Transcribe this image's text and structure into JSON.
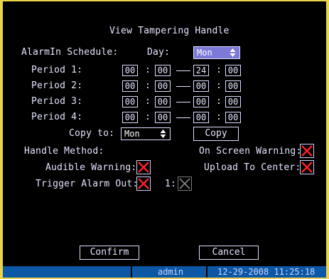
{
  "title": "View Tampering Handle",
  "schedule": {
    "label": "AlarmIn Schedule:",
    "day_label": "Day:",
    "day_value": "Mon",
    "periods": [
      {
        "label": "Period 1:",
        "start_h": "00",
        "start_m": "00",
        "end_h": "24",
        "end_m": "00"
      },
      {
        "label": "Period 2:",
        "start_h": "00",
        "start_m": "00",
        "end_h": "00",
        "end_m": "00"
      },
      {
        "label": "Period 3:",
        "start_h": "00",
        "start_m": "00",
        "end_h": "00",
        "end_m": "00"
      },
      {
        "label": "Period 4:",
        "start_h": "00",
        "start_m": "00",
        "end_h": "00",
        "end_m": "00"
      }
    ],
    "colon": ":",
    "copy_to_label": "Copy to:",
    "copy_to_value": "Mon",
    "copy_button": "Copy"
  },
  "handle": {
    "method_label": "Handle Method:",
    "on_screen_warning": "On Screen Warning:",
    "audible_warning": "Audible Warning:",
    "upload_to_center": "Upload To Center:",
    "trigger_alarm_out": "Trigger Alarm Out:",
    "alarm_out_1": "1:"
  },
  "buttons": {
    "confirm": "Confirm",
    "cancel": "Cancel"
  },
  "status": {
    "user": "admin",
    "datetime": "12-29-2008 11:25:18"
  },
  "colors": {
    "background": "#000000",
    "text": "#e4e4ff",
    "selected_dropdown": "#7d79d8",
    "checkbox_x": "#ff2020",
    "status_bar": "#0c57a6"
  },
  "icons": {
    "checkbox_checked": "red-x-icon",
    "checkbox_disabled": "gray-x-icon",
    "spinner": "up-down-arrow-icon"
  }
}
